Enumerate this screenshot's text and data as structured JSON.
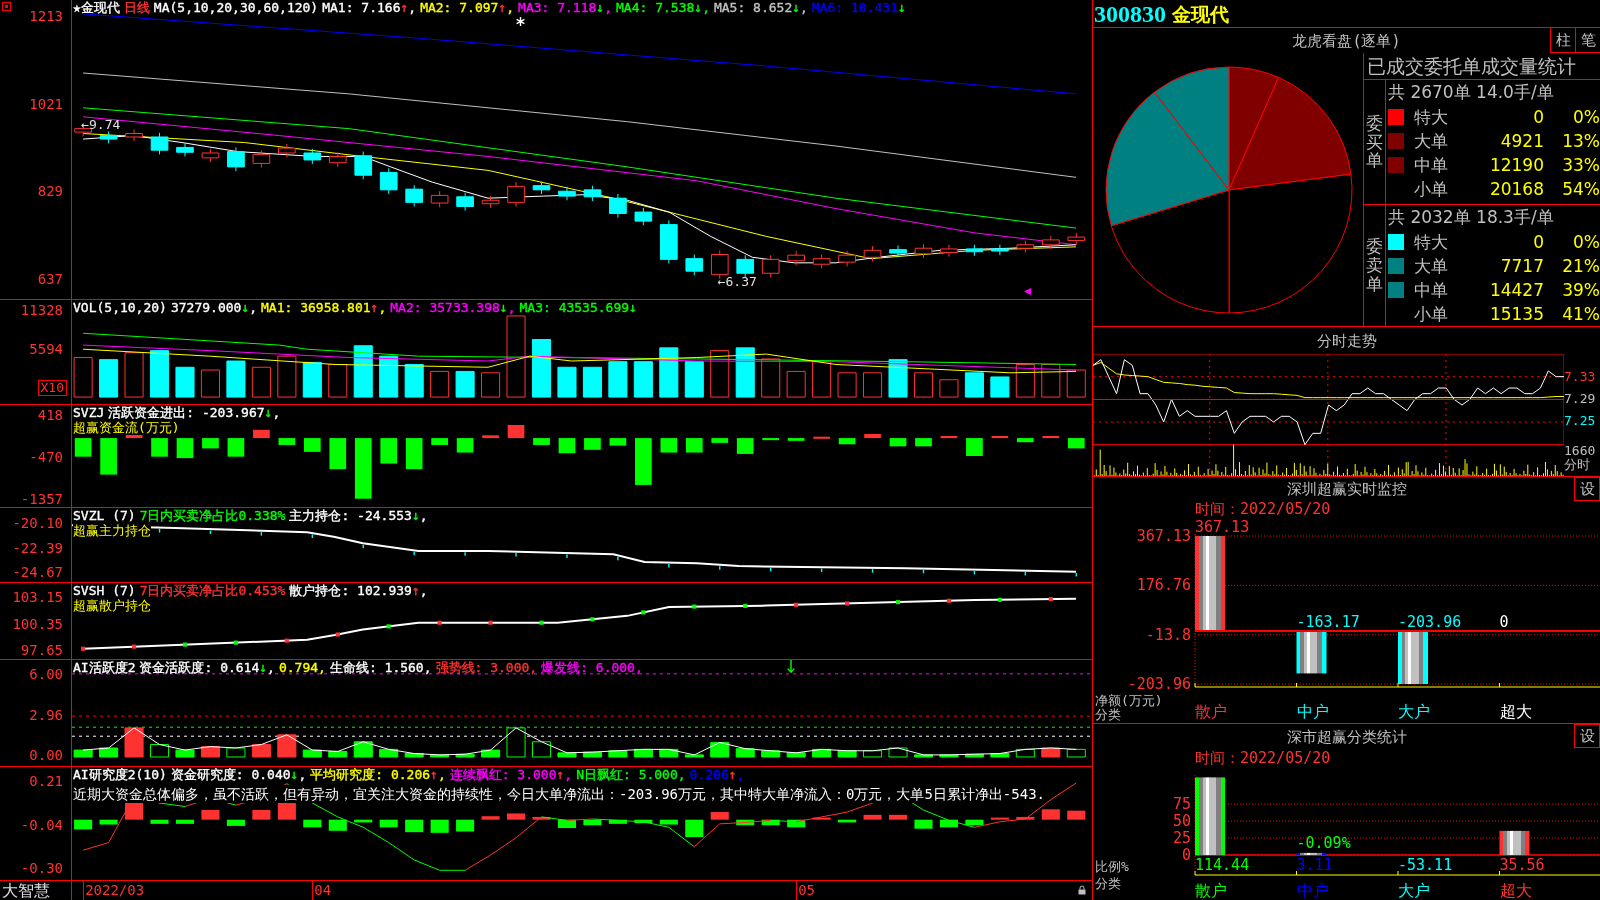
{
  "chart_panes": [
    {
      "kind": "candlestick",
      "legend": [
        {
          "text": "★金现代",
          "color": "#ffffff"
        },
        {
          "text": "日线",
          "color": "#ff3232"
        },
        {
          "text": "MA(5,10,20,30,60,120)",
          "color": "#ffffff"
        },
        {
          "text": "MA1: 7.166",
          "color": "#ffffff",
          "arrow": "↑",
          "rising": true,
          "tail": ","
        },
        {
          "text": "MA2: 7.097",
          "color": "#ffff00",
          "arrow": "↑",
          "rising": true,
          "tail": ","
        },
        {
          "text": "MA3: 7.118",
          "color": "#ff00ff",
          "arrow": "↓",
          "rising": false,
          "tail": ","
        },
        {
          "text": "MA4: 7.538",
          "color": "#00ff00",
          "arrow": "↓",
          "rising": false,
          "tail": ","
        },
        {
          "text": "MA5: 8.652",
          "color": "#c0c0c0",
          "arrow": "↓",
          "rising": false,
          "tail": ","
        },
        {
          "text": "MA6: 10.431",
          "color": "#0000ff",
          "arrow": "↓",
          "rising": false
        }
      ],
      "axis_labels": [
        "1213",
        "1021",
        "829",
        "637"
      ],
      "annotations": [
        "←9.74",
        "←6.37"
      ]
    },
    {
      "kind": "volume",
      "legend": [
        {
          "text": "VOL(5,10,20)",
          "color": "#ffffff"
        },
        {
          "text": "37279.000",
          "color": "#ffffff",
          "arrow": "↓",
          "rising": false,
          "tail": ","
        },
        {
          "text": "MA1: 36958.801",
          "color": "#ffff00",
          "arrow": "↑",
          "rising": true,
          "tail": ","
        },
        {
          "text": "MA2: 35733.398",
          "color": "#ff00ff",
          "arrow": "↓",
          "rising": false,
          "tail": ","
        },
        {
          "text": "MA3: 43535.699",
          "color": "#00ff00",
          "arrow": "↓",
          "rising": false
        }
      ],
      "axis_labels": [
        "11328",
        "5594"
      ],
      "unit_label": "X10"
    },
    {
      "kind": "fund_flow",
      "legend": [
        {
          "text": "SVZJ",
          "color": "#ffffff"
        },
        {
          "text": "活跃资金进出: -203.967",
          "color": "#ffffff",
          "arrow": "↓",
          "rising": false,
          "tail": ","
        }
      ],
      "subtitle": "超赢资金流(万元)",
      "axis_labels": [
        "418",
        "-470",
        "-1357"
      ]
    },
    {
      "kind": "main_holding",
      "legend": [
        {
          "text": "SVZL (7)",
          "color": "#ffffff"
        },
        {
          "text": "7日内买卖净占比0.338%",
          "color": "#00ff00"
        },
        {
          "text": "主力持仓: -24.553",
          "color": "#ffffff",
          "arrow": "↓",
          "rising": false,
          "tail": ","
        }
      ],
      "subtitle": "超赢主力持仓",
      "axis_labels": [
        "-20.10",
        "-22.39",
        "-24.67"
      ]
    },
    {
      "kind": "retail_holding",
      "legend": [
        {
          "text": "SVSH (7)",
          "color": "#ffffff"
        },
        {
          "text": "7日内买卖净占比0.453%",
          "color": "#ff3232"
        },
        {
          "text": "散户持仓: 102.939",
          "color": "#ffffff",
          "arrow": "↑",
          "rising": true,
          "tail": ","
        }
      ],
      "subtitle": "超赢散户持仓",
      "axis_labels": [
        "103.15",
        "100.35",
        "97.65"
      ]
    },
    {
      "kind": "activity",
      "legend": [
        {
          "text": "AI活跃度2",
          "color": "#ffffff"
        },
        {
          "text": "资金活跃度: 0.614",
          "color": "#ffffff",
          "arrow": "↓",
          "rising": false,
          "tail": ","
        },
        {
          "text": "0.794,",
          "color": "#ffff00"
        },
        {
          "text": "生命线: 1.560,",
          "color": "#ffffff"
        },
        {
          "text": "强势线: 3.000,",
          "color": "#ff3232"
        },
        {
          "text": "爆发线: 6.000,",
          "color": "#ff00ff"
        }
      ],
      "axis_labels": [
        "6.00",
        "2.96",
        "0.00"
      ]
    },
    {
      "kind": "research",
      "legend": [
        {
          "text": "AI研究度2(10)",
          "color": "#ffffff"
        },
        {
          "text": "资金研究度: 0.040",
          "color": "#ffffff",
          "arrow": "↓",
          "rising": false,
          "tail": ","
        },
        {
          "text": "平均研究度: 0.206",
          "color": "#ffff00",
          "arrow": "↑",
          "rising": true,
          "tail": ","
        },
        {
          "text": "连续飘红: 3.000",
          "color": "#ff00ff",
          "arrow": "↑",
          "rising": true,
          "tail": ","
        },
        {
          "text": "N日飘红: 5.000,",
          "color": "#00ff00"
        },
        {
          "text": "0.206",
          "color": "#0000ff",
          "arrow": "↑",
          "rising": true,
          "tail": ","
        }
      ],
      "note": "近期大资金总体偏多，虽不活跃，但有异动，宜关注大资金的持续性，今日大单净流出：-203.96万元，其中特大单净流入：0万元，大单5日累计净出-543.",
      "axis_labels": [
        "0.21",
        "-0.04",
        "-0.30"
      ]
    }
  ],
  "footer": {
    "brand": "大智慧",
    "dates": [
      "2022/03",
      "04",
      "05"
    ]
  },
  "stock": {
    "code": "300830",
    "name": "金现代"
  },
  "order_book": {
    "title": "龙虎看盘(逐单)",
    "view_buttons": [
      "柱",
      "笔"
    ],
    "chart_data": {
      "type": "pie",
      "values": [
        0,
        6.6,
        16.35,
        27.05,
        20.3,
        19.35,
        10.35,
        0
      ]
    },
    "table_title": "已成交委托单成交量统计",
    "groups": [
      {
        "label": "委买单",
        "summary": "共 2670单 14.0手/单",
        "rows": [
          {
            "name": "特大",
            "volume": "0",
            "percent": "0%",
            "color": "#ff0000"
          },
          {
            "name": "大单",
            "volume": "4921",
            "percent": "13%",
            "color": "#800000"
          },
          {
            "name": "中单",
            "volume": "12190",
            "percent": "33%",
            "color": "#800000"
          },
          {
            "name": "小单",
            "volume": "20168",
            "percent": "54%"
          }
        ]
      },
      {
        "label": "委卖单",
        "summary": "共 2032单 18.3手/单",
        "rows": [
          {
            "name": "特大",
            "volume": "0",
            "percent": "0%",
            "color": "#00ffff"
          },
          {
            "name": "大单",
            "volume": "7717",
            "percent": "21%",
            "color": "#008080"
          },
          {
            "name": "中单",
            "volume": "14427",
            "percent": "39%",
            "color": "#008080"
          },
          {
            "name": "小单",
            "volume": "15135",
            "percent": "41%"
          }
        ]
      }
    ]
  },
  "intraday": {
    "title": "分时走势",
    "price_labels": [
      {
        "text": "7.33",
        "color": "#ff3232"
      },
      {
        "text": "7.29",
        "color": "#c0c0c0"
      },
      {
        "text": "7.25",
        "color": "#00ffff"
      }
    ],
    "volume_labels": [
      "1660",
      "分时"
    ],
    "chart_data": {
      "type": "line",
      "ylim": [
        7.21,
        7.37
      ],
      "yticks": [
        7.33,
        7.29,
        7.25
      ],
      "grid": true,
      "series": [
        {
          "color": "#ffffff",
          "values": [
            7.35,
            7.36,
            7.33,
            7.3,
            7.36,
            7.35,
            7.3,
            7.3,
            7.28,
            7.25,
            7.29,
            7.26,
            7.27,
            7.26,
            7.26,
            7.26,
            7.26,
            7.27,
            7.23,
            7.25,
            7.26,
            7.26,
            7.26,
            7.25,
            7.26,
            7.26,
            7.25,
            7.21,
            7.23,
            7.23,
            7.28,
            7.27,
            7.28,
            7.3,
            7.3,
            7.31,
            7.3,
            7.3,
            7.29,
            7.28,
            7.27,
            7.29,
            7.3,
            7.3,
            7.31,
            7.31,
            7.29,
            7.28,
            7.29,
            7.31,
            7.3,
            7.31,
            7.3,
            7.31,
            7.31,
            7.3,
            7.3,
            7.31,
            7.34,
            7.33,
            7.33
          ]
        },
        {
          "color": "#ffff00",
          "values": [
            7.35,
            7.355,
            7.345,
            7.335,
            7.333,
            7.332,
            7.331,
            7.33,
            7.325,
            7.32,
            7.319,
            7.318,
            7.316,
            7.315,
            7.313,
            7.312,
            7.311,
            7.31,
            7.302,
            7.301,
            7.3,
            7.3,
            7.3,
            7.3,
            7.299,
            7.298,
            7.297,
            7.293,
            7.293,
            7.293,
            7.293,
            7.293,
            7.293,
            7.293,
            7.293,
            7.293,
            7.293,
            7.293,
            7.293,
            7.293,
            7.293,
            7.293,
            7.293,
            7.293,
            7.293,
            7.293,
            7.293,
            7.293,
            7.293,
            7.293,
            7.293,
            7.293,
            7.293,
            7.293,
            7.293,
            7.293,
            7.293,
            7.293,
            7.294,
            7.295,
            7.295
          ]
        }
      ]
    }
  },
  "realtime_monitor": {
    "title": "深圳超赢实时监控",
    "settings_button": "设",
    "time": "时间：2022/05/20",
    "chart_data": {
      "type": "bar",
      "xlabel": "分类",
      "ylabel": "净额(万元)",
      "categories": [
        "散户",
        "中户",
        "大户",
        "超大"
      ],
      "values": [
        367.13,
        -163.17,
        -203.96,
        0
      ],
      "value_labels": [
        "367.13",
        "-163.17",
        "-203.96",
        "0"
      ],
      "colors": [
        "#ff3232",
        "#00ffff",
        "#00ffff",
        "#ffffff"
      ],
      "ylim": [
        -203.96,
        367.13
      ],
      "yticks": [
        367.13,
        176.76,
        -13.8,
        -203.96
      ],
      "grid": true
    }
  },
  "category_stats": {
    "title": "深市超赢分类统计",
    "settings_button": "设",
    "time": "时间：2022/05/20",
    "chart_data": {
      "type": "bar",
      "xlabel": "分类",
      "ylabel": "比例%",
      "categories": [
        "散户",
        "中户",
        "大户",
        "超大"
      ],
      "values": [
        114.44,
        3.11,
        null,
        35.56
      ],
      "value_labels": [
        "114.44",
        "3.11",
        "-53.11",
        "35.56"
      ],
      "colors": [
        "#00ff00",
        "#0000ff",
        "#00ffff",
        "#ff3232"
      ],
      "ylim": [
        0,
        115
      ],
      "yticks": [
        {
          "value": 0,
          "label": "0"
        },
        {
          "value": 25,
          "label": "25"
        },
        {
          "value": 50,
          "label": "50"
        },
        {
          "value": 75,
          "label": "75"
        }
      ],
      "grid": true,
      "annotations": [
        {
          "x": "中户",
          "y": 3.11,
          "text": "-0.09%"
        }
      ]
    }
  }
}
